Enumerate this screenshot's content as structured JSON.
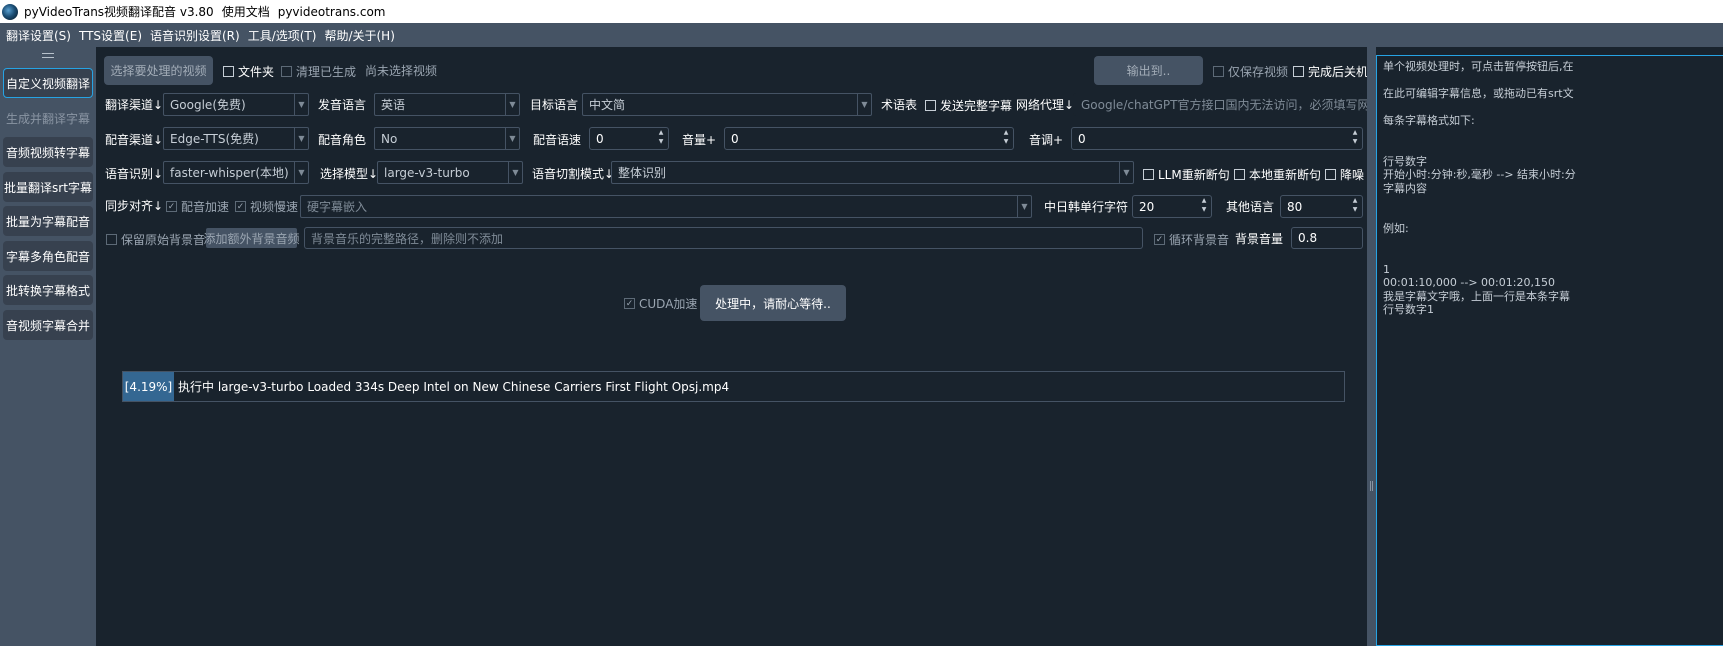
{
  "window": {
    "title": "pyVideoTrans视频翻译配音 v3.80",
    "docs_link": "使用文档",
    "site_link": "pyvideotrans.com"
  },
  "menu": [
    "翻译设置(S)",
    "TTS设置(E)",
    "语音识别设置(R)",
    "工具/选项(T)",
    "帮助/关于(H)"
  ],
  "sidebar": {
    "items": [
      {
        "label": "自定义视频翻译",
        "active": true,
        "enabled": true
      },
      {
        "label": "生成并翻译字幕",
        "active": false,
        "enabled": false
      },
      {
        "label": "音频视频转字幕",
        "active": false,
        "enabled": true
      },
      {
        "label": "批量翻译srt字幕",
        "active": false,
        "enabled": true
      },
      {
        "label": "批量为字幕配音",
        "active": false,
        "enabled": true
      },
      {
        "label": "字幕多角色配音",
        "active": false,
        "enabled": true
      },
      {
        "label": "批转换字幕格式",
        "active": false,
        "enabled": true
      },
      {
        "label": "音视频字幕合并",
        "active": false,
        "enabled": true
      }
    ]
  },
  "row1": {
    "select_video_button": "选择要处理的视频",
    "folder_checkbox": "文件夹",
    "folder_checked": false,
    "clear_checkbox": "清理已生成",
    "clear_checked": false,
    "no_video_text": "尚未选择视频",
    "output_button": "输出到..",
    "only_video_checkbox": "仅保存视频",
    "only_video_checked": false,
    "shutdown_checkbox": "完成后关机",
    "shutdown_checked": false
  },
  "row2": {
    "translate_channel_label": "翻译渠道↓",
    "translate_channel_value": "Google(免费)",
    "source_lang_label": "发音语言",
    "source_lang_value": "英语",
    "target_lang_label": "目标语言",
    "target_lang_value": "中文简",
    "glossary_label": "术语表",
    "send_full_checkbox": "发送完整字幕",
    "send_full_checked": false,
    "proxy_label": "网络代理↓",
    "proxy_placeholder": "Google/chatGPT官方接口国内无法访问，必须填写网..."
  },
  "row3": {
    "tts_channel_label": "配音渠道↓",
    "tts_channel_value": "Edge-TTS(免费)",
    "voice_role_label": "配音角色",
    "voice_role_value": "No",
    "speech_rate_label": "配音语速",
    "speech_rate_value": "0",
    "volume_label": "音量+",
    "volume_value": "0",
    "pitch_label": "音调+",
    "pitch_value": "0"
  },
  "row4": {
    "asr_label": "语音识别↓",
    "asr_value": "faster-whisper(本地)",
    "model_label": "选择模型↓",
    "model_value": "large-v3-turbo",
    "split_mode_label": "语音切割模式↓",
    "split_mode_value": "整体识别",
    "llm_resplit_checkbox": "LLM重新断句",
    "llm_resplit_checked": false,
    "local_resplit_checkbox": "本地重新断句",
    "local_resplit_checked": false,
    "denoise_checkbox": "降噪",
    "denoise_checked": false
  },
  "row5": {
    "sync_label": "同步对齐↓",
    "audio_speedup_checkbox": "配音加速",
    "audio_speedup_checked": true,
    "video_slowdown_checkbox": "视频慢速",
    "video_slowdown_checked": true,
    "subtitle_mode_value": "硬字幕嵌入",
    "cjk_chars_label": "中日韩单行字符",
    "cjk_chars_value": "20",
    "other_lang_label": "其他语言",
    "other_lang_value": "80"
  },
  "row6": {
    "keep_bg_checkbox": "保留原始背景音",
    "keep_bg_checked": false,
    "add_bg_button": "添加额外背景音频",
    "bg_path_placeholder": "背景音乐的完整路径，删除则不添加",
    "loop_bg_checkbox": "循环背景音",
    "loop_bg_checked": true,
    "bg_volume_label": "背景音量",
    "bg_volume_value": "0.8"
  },
  "action": {
    "cuda_checkbox": "CUDA加速",
    "cuda_checked": true,
    "start_button": "处理中，请耐心等待.."
  },
  "progress": {
    "percent_label": "[4.19%]",
    "percent": 4.19,
    "status_text": "执行中 large-v3-turbo Loaded 334s   Deep Intel on New Chinese Carriers First Flight Opsj.mp4"
  },
  "subtitle_editor": {
    "lines": [
      "单个视频处理时，可点击暂停按钮后,在",
      "",
      " 在此可编辑字幕信息，或拖动已有srt文",
      "",
      "每条字幕格式如下:",
      "",
      "",
      "行号数字",
      "开始小时:分钟:秒,毫秒 --> 结束小时:分",
      "字幕内容",
      "",
      "",
      "例如:",
      "",
      "",
      "1",
      "00:01:10,000 --> 00:01:20,150",
      "我是字幕文字哦，上面一行是本条字幕",
      "行号数字1"
    ]
  },
  "colors": {
    "background": "#19232d",
    "panel": "#455364",
    "accent": "#26a3e4",
    "progress_fill": "#346792"
  }
}
